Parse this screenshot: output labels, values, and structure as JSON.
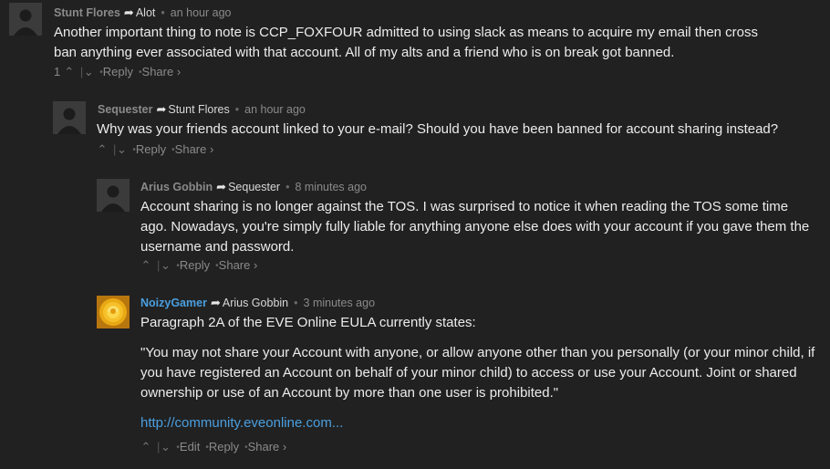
{
  "comments": [
    {
      "author": "Stunt Flores",
      "reply_to": "Alot",
      "time": "an hour ago",
      "body": [
        "Another important thing to note is CCP_FOXFOUR admitted to using slack as means to acquire my email then cross ban anything ever associated with that account. All of my alts and a friend who is on break got banned."
      ],
      "votes": "1",
      "reply_label": "Reply",
      "share_label": "Share ›"
    },
    {
      "author": "Sequester",
      "reply_to": "Stunt Flores",
      "time": "an hour ago",
      "body": [
        "Why was your friends account linked to your e-mail? Should you have been banned for account sharing instead?"
      ],
      "reply_label": "Reply",
      "share_label": "Share ›"
    },
    {
      "author": "Arius Gobbin",
      "reply_to": "Sequester",
      "time": "8 minutes ago",
      "body": [
        "Account sharing is no longer against the TOS. I was surprised to notice it when reading the TOS some time ago. Nowadays, you're simply fully liable for anything anyone else does with your account if you gave them the username and password."
      ],
      "reply_label": "Reply",
      "share_label": "Share ›"
    },
    {
      "author": "NoizyGamer",
      "reply_to": "Arius Gobbin",
      "time": "3 minutes ago",
      "body": [
        "Paragraph 2A of the EVE Online EULA currently states:",
        "\"You may not share your Account with anyone, or allow anyone other than you personally (or your minor child, if you have registered an Account on behalf of your minor child) to access or use your Account. Joint or shared ownership or use of an Account by more than one user is prohibited.\""
      ],
      "link": "http://community.eveonline.com...",
      "edit_label": "Edit",
      "reply_label": "Reply",
      "share_label": "Share ›"
    }
  ],
  "icons": {
    "upvote": "^",
    "downvote": "v",
    "reply_arrow": "curved-arrow"
  },
  "colors": {
    "background": "#212121",
    "link": "#4a9fe0",
    "muted": "#8a8a8a"
  }
}
